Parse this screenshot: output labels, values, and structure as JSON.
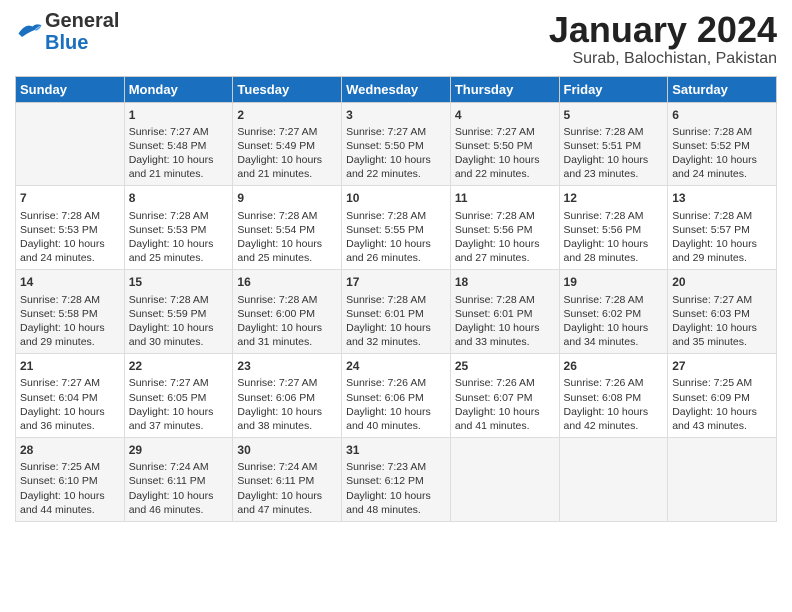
{
  "header": {
    "logo": {
      "line1": "General",
      "line2": "Blue"
    },
    "title": "January 2024",
    "subtitle": "Surab, Balochistan, Pakistan"
  },
  "weekdays": [
    "Sunday",
    "Monday",
    "Tuesday",
    "Wednesday",
    "Thursday",
    "Friday",
    "Saturday"
  ],
  "weeks": [
    [
      {
        "day": "",
        "content": ""
      },
      {
        "day": "1",
        "content": "Sunrise: 7:27 AM\nSunset: 5:48 PM\nDaylight: 10 hours\nand 21 minutes."
      },
      {
        "day": "2",
        "content": "Sunrise: 7:27 AM\nSunset: 5:49 PM\nDaylight: 10 hours\nand 21 minutes."
      },
      {
        "day": "3",
        "content": "Sunrise: 7:27 AM\nSunset: 5:50 PM\nDaylight: 10 hours\nand 22 minutes."
      },
      {
        "day": "4",
        "content": "Sunrise: 7:27 AM\nSunset: 5:50 PM\nDaylight: 10 hours\nand 22 minutes."
      },
      {
        "day": "5",
        "content": "Sunrise: 7:28 AM\nSunset: 5:51 PM\nDaylight: 10 hours\nand 23 minutes."
      },
      {
        "day": "6",
        "content": "Sunrise: 7:28 AM\nSunset: 5:52 PM\nDaylight: 10 hours\nand 24 minutes."
      }
    ],
    [
      {
        "day": "7",
        "content": "Sunrise: 7:28 AM\nSunset: 5:53 PM\nDaylight: 10 hours\nand 24 minutes."
      },
      {
        "day": "8",
        "content": "Sunrise: 7:28 AM\nSunset: 5:53 PM\nDaylight: 10 hours\nand 25 minutes."
      },
      {
        "day": "9",
        "content": "Sunrise: 7:28 AM\nSunset: 5:54 PM\nDaylight: 10 hours\nand 25 minutes."
      },
      {
        "day": "10",
        "content": "Sunrise: 7:28 AM\nSunset: 5:55 PM\nDaylight: 10 hours\nand 26 minutes."
      },
      {
        "day": "11",
        "content": "Sunrise: 7:28 AM\nSunset: 5:56 PM\nDaylight: 10 hours\nand 27 minutes."
      },
      {
        "day": "12",
        "content": "Sunrise: 7:28 AM\nSunset: 5:56 PM\nDaylight: 10 hours\nand 28 minutes."
      },
      {
        "day": "13",
        "content": "Sunrise: 7:28 AM\nSunset: 5:57 PM\nDaylight: 10 hours\nand 29 minutes."
      }
    ],
    [
      {
        "day": "14",
        "content": "Sunrise: 7:28 AM\nSunset: 5:58 PM\nDaylight: 10 hours\nand 29 minutes."
      },
      {
        "day": "15",
        "content": "Sunrise: 7:28 AM\nSunset: 5:59 PM\nDaylight: 10 hours\nand 30 minutes."
      },
      {
        "day": "16",
        "content": "Sunrise: 7:28 AM\nSunset: 6:00 PM\nDaylight: 10 hours\nand 31 minutes."
      },
      {
        "day": "17",
        "content": "Sunrise: 7:28 AM\nSunset: 6:01 PM\nDaylight: 10 hours\nand 32 minutes."
      },
      {
        "day": "18",
        "content": "Sunrise: 7:28 AM\nSunset: 6:01 PM\nDaylight: 10 hours\nand 33 minutes."
      },
      {
        "day": "19",
        "content": "Sunrise: 7:28 AM\nSunset: 6:02 PM\nDaylight: 10 hours\nand 34 minutes."
      },
      {
        "day": "20",
        "content": "Sunrise: 7:27 AM\nSunset: 6:03 PM\nDaylight: 10 hours\nand 35 minutes."
      }
    ],
    [
      {
        "day": "21",
        "content": "Sunrise: 7:27 AM\nSunset: 6:04 PM\nDaylight: 10 hours\nand 36 minutes."
      },
      {
        "day": "22",
        "content": "Sunrise: 7:27 AM\nSunset: 6:05 PM\nDaylight: 10 hours\nand 37 minutes."
      },
      {
        "day": "23",
        "content": "Sunrise: 7:27 AM\nSunset: 6:06 PM\nDaylight: 10 hours\nand 38 minutes."
      },
      {
        "day": "24",
        "content": "Sunrise: 7:26 AM\nSunset: 6:06 PM\nDaylight: 10 hours\nand 40 minutes."
      },
      {
        "day": "25",
        "content": "Sunrise: 7:26 AM\nSunset: 6:07 PM\nDaylight: 10 hours\nand 41 minutes."
      },
      {
        "day": "26",
        "content": "Sunrise: 7:26 AM\nSunset: 6:08 PM\nDaylight: 10 hours\nand 42 minutes."
      },
      {
        "day": "27",
        "content": "Sunrise: 7:25 AM\nSunset: 6:09 PM\nDaylight: 10 hours\nand 43 minutes."
      }
    ],
    [
      {
        "day": "28",
        "content": "Sunrise: 7:25 AM\nSunset: 6:10 PM\nDaylight: 10 hours\nand 44 minutes."
      },
      {
        "day": "29",
        "content": "Sunrise: 7:24 AM\nSunset: 6:11 PM\nDaylight: 10 hours\nand 46 minutes."
      },
      {
        "day": "30",
        "content": "Sunrise: 7:24 AM\nSunset: 6:11 PM\nDaylight: 10 hours\nand 47 minutes."
      },
      {
        "day": "31",
        "content": "Sunrise: 7:23 AM\nSunset: 6:12 PM\nDaylight: 10 hours\nand 48 minutes."
      },
      {
        "day": "",
        "content": ""
      },
      {
        "day": "",
        "content": ""
      },
      {
        "day": "",
        "content": ""
      }
    ]
  ]
}
